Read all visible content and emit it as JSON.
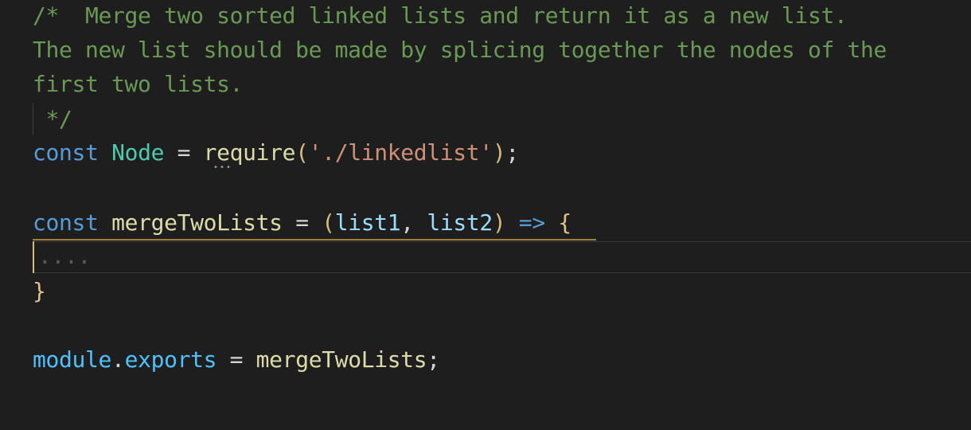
{
  "comment": {
    "line1": "/*  Merge two sorted linked lists and return it as a new list.",
    "line2": "The new list should be made by splicing together the nodes of the",
    "line3": "first two lists.",
    "line4": " */"
  },
  "require_stmt": {
    "keyword": "const",
    "name": "Node",
    "op": "=",
    "fn": "require",
    "open": "(",
    "arg": "'./linkedlist'",
    "close": ")",
    "semi": ";"
  },
  "func_decl": {
    "keyword": "const",
    "name": "mergeTwoLists",
    "op": "=",
    "open": "(",
    "param1": "list1",
    "comma": ",",
    "param2": "list2",
    "close": ")",
    "arrow": "=>",
    "brace_open": "{"
  },
  "body_line": "....",
  "brace_close": "}",
  "export_stmt": {
    "obj": "module",
    "dot": ".",
    "prop": "exports",
    "op": "=",
    "value": "mergeTwoLists",
    "semi": ";"
  },
  "theme": {
    "background": "#1e1e1e",
    "comment": "#6a9955",
    "keyword": "#569cd6"
  }
}
